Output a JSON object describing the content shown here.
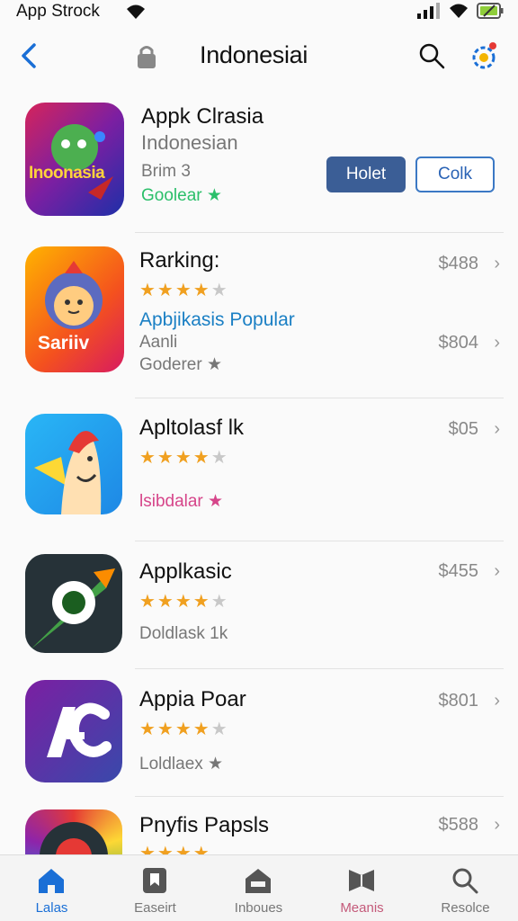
{
  "status_bar": {
    "carrier": "App Strock"
  },
  "nav": {
    "title": "Indonesiai"
  },
  "featured": {
    "name": "Appk Clrasia",
    "subtitle": "Indonesian",
    "meta": "Brim 3",
    "tag": "Goolear ★",
    "icon_text": "Inoonasia",
    "primary_button": "Holet",
    "outline_button": "Colk"
  },
  "rows": [
    {
      "title": "Rarking:",
      "stars": "★★★★",
      "dim_star": "★",
      "line1": "Apbjikasis Popular",
      "line2": "Aanli",
      "line3": "Goderer ★",
      "price1": "$488",
      "price2": "$804",
      "icon_text": "Sariiv"
    },
    {
      "title": "Apltolasf lk",
      "stars": "★★★★",
      "dim_star": "★",
      "line1": "lsibdalar ★",
      "price1": "$05"
    },
    {
      "title": "Applkasic",
      "stars": "★★★★",
      "dim_star": "★",
      "line1": "Doldlask 1k",
      "price1": "$455"
    },
    {
      "title": "Appia Poar",
      "stars": "★★★★",
      "dim_star": "★",
      "line1": "Loldlaex ★",
      "price1": "$801"
    },
    {
      "title": "Pnyfis Papsls",
      "stars": "★★★★",
      "price1": "$588"
    }
  ],
  "tabs": [
    {
      "label": "Lalas",
      "icon": "home-icon",
      "active": true
    },
    {
      "label": "Easeirt",
      "icon": "apps-icon"
    },
    {
      "label": "Inboues",
      "icon": "inbox-icon"
    },
    {
      "label": "Meanis",
      "icon": "book-icon"
    },
    {
      "label": "Resolce",
      "icon": "search-icon"
    }
  ],
  "colors": {
    "accent": "#2a63b5",
    "active_tab": "#1a6fd6",
    "star": "#f0a020",
    "green": "#2bbf6a",
    "pink": "#d6458a"
  }
}
